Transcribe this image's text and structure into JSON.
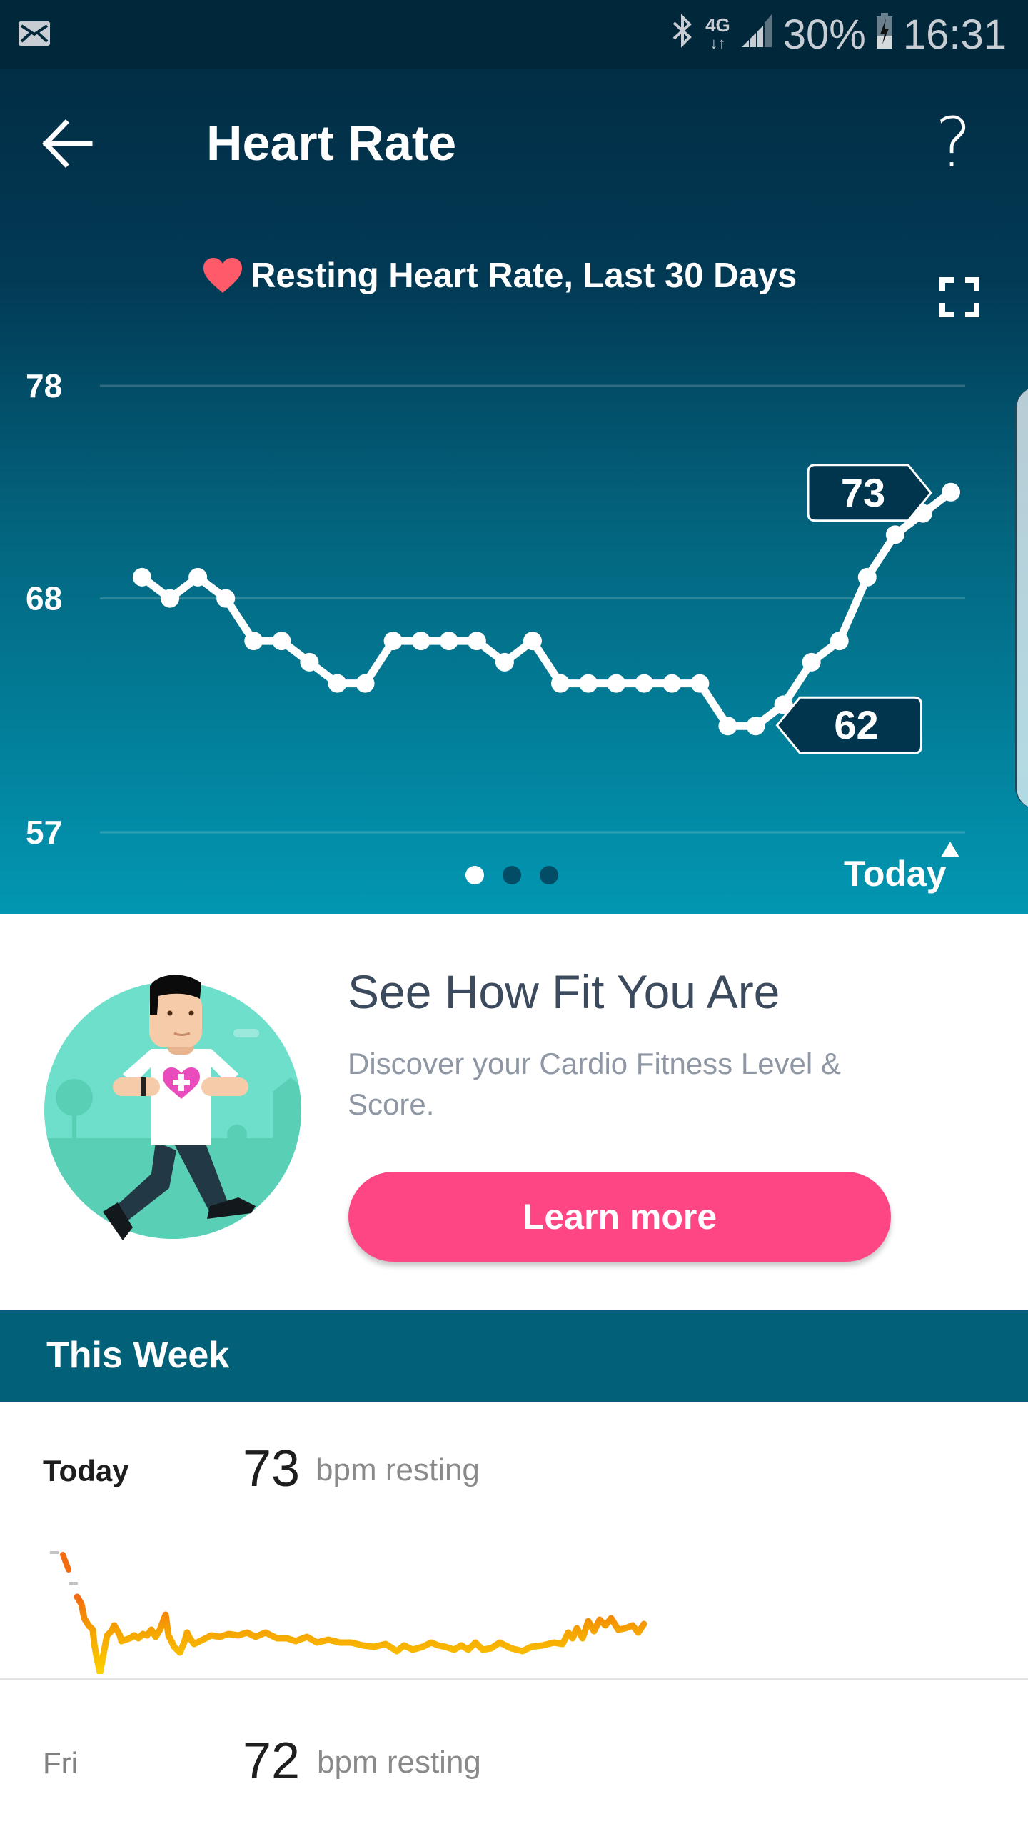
{
  "status_bar": {
    "notification_icon": "mail-icon",
    "bluetooth_icon": "bluetooth-icon",
    "network": "4G",
    "signal_icon": "signal-icon",
    "battery": "30%",
    "battery_icon": "battery-charging-icon",
    "time": "16:31"
  },
  "header": {
    "back_icon": "arrow-left-icon",
    "title": "Heart Rate",
    "help_label": "?"
  },
  "chart_header": {
    "icon": "heart-icon",
    "title": "Resting Heart Rate, Last 30 Days",
    "expand_icon": "expand-icon"
  },
  "chart_data": {
    "type": "line",
    "title": "Resting Heart Rate, Last 30 Days",
    "xlabel": "",
    "ylabel": "",
    "ylim": [
      57,
      78
    ],
    "yticks": [
      78,
      68,
      57
    ],
    "grid": true,
    "x_end_label": "Today",
    "x": [
      1,
      2,
      3,
      4,
      5,
      6,
      7,
      8,
      9,
      10,
      11,
      12,
      13,
      14,
      15,
      16,
      17,
      18,
      19,
      20,
      21,
      22,
      23,
      24,
      25,
      26,
      27,
      28,
      29,
      30
    ],
    "series": [
      {
        "name": "Resting Heart Rate",
        "color": "#ffffff",
        "values": [
          69,
          68,
          69,
          68,
          66,
          66,
          65,
          64,
          64,
          66,
          66,
          66,
          66,
          65,
          66,
          64,
          64,
          64,
          64,
          64,
          64,
          62,
          62,
          63,
          65,
          66,
          69,
          71,
          72,
          73
        ]
      }
    ],
    "annotations": [
      {
        "label": "73",
        "index": 29,
        "kind": "max"
      },
      {
        "label": "62",
        "index": 22,
        "kind": "min"
      }
    ]
  },
  "pager": {
    "count": 3,
    "active": 0
  },
  "promo": {
    "title": "See How Fit You Are",
    "description": "Discover your Cardio Fitness Level & Score.",
    "button_label": "Learn more",
    "button_color": "#fe4685"
  },
  "this_week": {
    "header": "This Week",
    "days": [
      {
        "label": "Today",
        "value": "73",
        "unit": "bpm resting"
      },
      {
        "label": "Fri",
        "value": "72",
        "unit": "bpm resting"
      }
    ]
  },
  "colors": {
    "header_dark": "#022d45",
    "header_light": "#0297b2",
    "week_header": "#026178",
    "accent_pink": "#fe4685",
    "heart_red": "#ff5a6a",
    "sparkline_low": "#fcd000",
    "sparkline_high": "#f26b10"
  }
}
